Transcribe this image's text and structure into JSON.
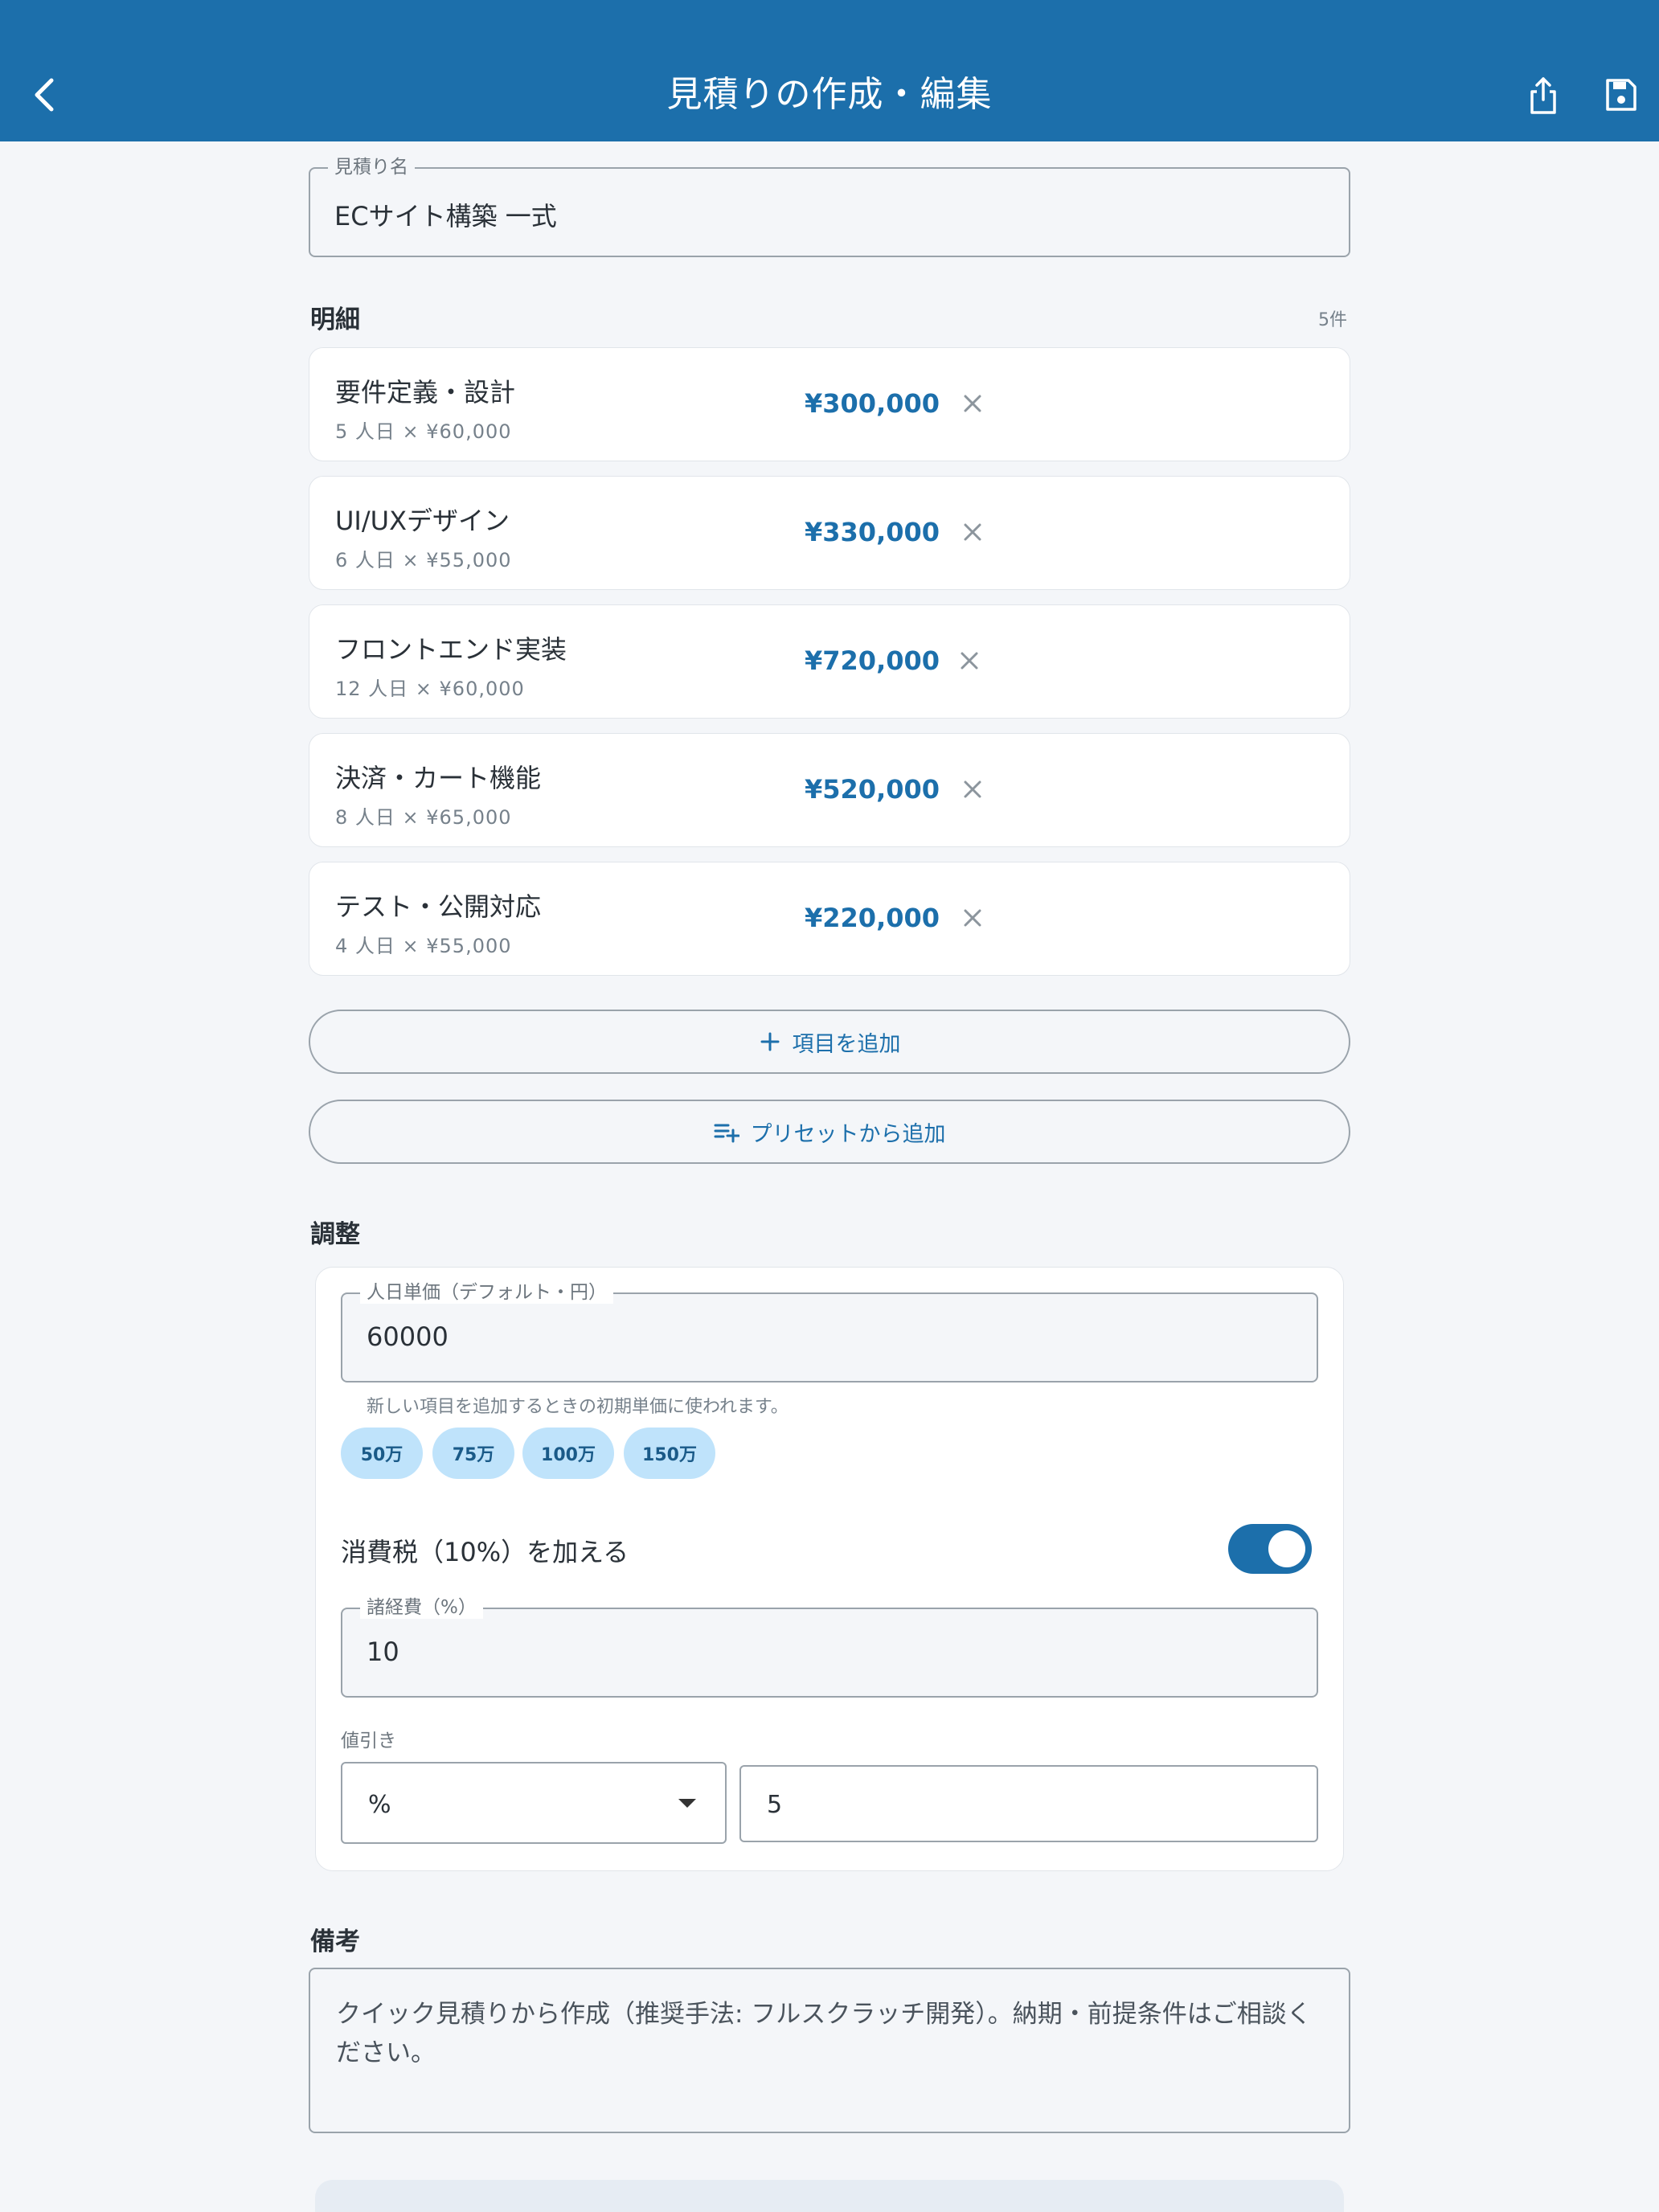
{
  "header": {
    "title": "見積りの作成・編集",
    "colors": {
      "appbar": "#1c6fab",
      "accent": "#1c6fab",
      "chip": "#bfe3fb"
    }
  },
  "estimate_name": {
    "label": "見積り名",
    "value": "ECサイト構築 一式"
  },
  "details": {
    "title": "明細",
    "count": "5件",
    "items": [
      {
        "name": "要件定義・設計",
        "detail": "5 人日 × ¥60,000",
        "amount": "¥300,000"
      },
      {
        "name": "UI/UXデザイン",
        "detail": "6 人日 × ¥55,000",
        "amount": "¥330,000"
      },
      {
        "name": "フロントエンド実装",
        "detail": "12 人日 × ¥60,000",
        "amount": "¥720,000"
      },
      {
        "name": "決済・カート機能",
        "detail": "8 人日 × ¥65,000",
        "amount": "¥520,000"
      },
      {
        "name": "テスト・公開対応",
        "detail": "4 人日 × ¥55,000",
        "amount": "¥220,000"
      }
    ],
    "add_item_label": "項目を追加",
    "add_preset_label": "プリセットから追加"
  },
  "adjustments": {
    "title": "調整",
    "day_rate": {
      "label": "人日単価（デフォルト・円）",
      "value": "60000",
      "hint": "新しい項目を追加するときの初期単価に使われます。"
    },
    "chips": [
      "50万",
      "75万",
      "100万",
      "150万"
    ],
    "tax": {
      "label": "消費税（10%）を加える",
      "enabled": true
    },
    "expenses": {
      "label": "諸経費（%）",
      "value": "10"
    },
    "discount": {
      "label": "値引き",
      "type": "%",
      "value": "5"
    }
  },
  "notes": {
    "title": "備考",
    "text": "クイック見積りから作成（推奨手法: フルスクラッチ開発）。納期・前提条件はご相談ください。"
  }
}
